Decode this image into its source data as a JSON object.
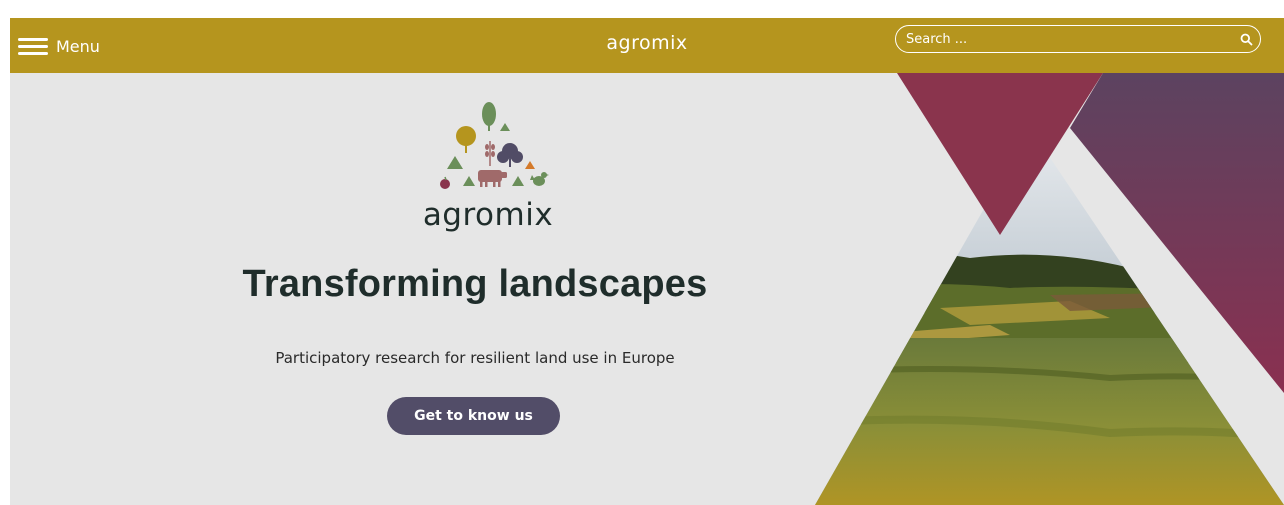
{
  "header": {
    "menu_label": "Menu",
    "site_title": "agromix",
    "search_placeholder": "Search ..."
  },
  "hero": {
    "logo_text": "agromix",
    "headline": "Transforming landscapes",
    "subheadline": "Participatory research for resilient land use in Europe",
    "cta_label": "Get to know us"
  },
  "colors": {
    "header_bg": "#b5951e",
    "hero_bg": "#e6e6e6",
    "cta_bg": "#524d68",
    "triangle_red": "#8a344d",
    "triangle_purple": "#5c4360"
  }
}
